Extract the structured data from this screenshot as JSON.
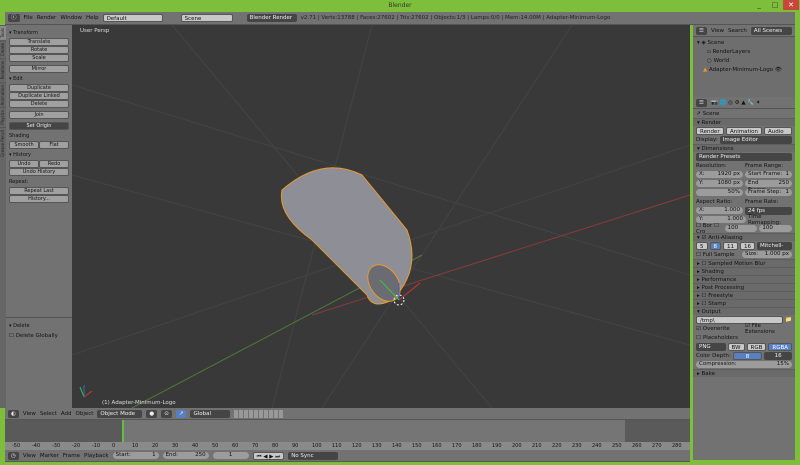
{
  "window": {
    "title": "Blender",
    "min": "_",
    "max": "□",
    "close": "✕"
  },
  "menu": {
    "items": [
      "File",
      "Render",
      "Window",
      "Help"
    ],
    "layout": "Default",
    "scene": "Scene",
    "engine": "Blender Render",
    "stats": "v2.71 | Verts:13788 | Faces:27602 | Tris:27602 | Objects:1/3 | Lamps:0/0 | Mem:14.00M | Adapter-Minimum-Logo"
  },
  "tools": {
    "transform": "Transform",
    "translate": "Translate",
    "rotate": "Rotate",
    "scale": "Scale",
    "mirror": "Mirror",
    "edit": "Edit",
    "duplicate": "Duplicate",
    "duplicate_linked": "Duplicate Linked",
    "delete": "Delete",
    "join": "Join",
    "set_origin": "Set Origin",
    "shading": "Shading",
    "smooth": "Smooth",
    "flat": "Flat",
    "history": "History",
    "undo": "Undo",
    "redo": "Redo",
    "undo_history": "Undo History",
    "repeat": "Repeat:",
    "repeat_last": "Repeat Last",
    "history_btn": "History...",
    "op_delete": "Delete",
    "delete_globally": "Delete Globally",
    "tabs": [
      "Tools",
      "Create",
      "Relations",
      "Animation",
      "Physics",
      "Grease Pencil"
    ]
  },
  "viewport": {
    "label": "User Persp",
    "object": "(1) Adapter-Minimum-Logo"
  },
  "view_header": {
    "items": [
      "View",
      "Select",
      "Add",
      "Object"
    ],
    "mode": "Object Mode",
    "orientation": "Global"
  },
  "timeline": {
    "ticks": [
      "-50",
      "-40",
      "-30",
      "-20",
      "-10",
      "0",
      "10",
      "20",
      "30",
      "40",
      "50",
      "60",
      "70",
      "80",
      "90",
      "100",
      "110",
      "120",
      "130",
      "140",
      "150",
      "160",
      "170",
      "180",
      "190",
      "200",
      "210",
      "220",
      "230",
      "240",
      "250",
      "260",
      "270",
      "280"
    ],
    "menu": [
      "View",
      "Marker",
      "Frame",
      "Playback"
    ],
    "start": "Start:",
    "start_val": "1",
    "end": "End:",
    "end_val": "250",
    "current": "1",
    "sync": "No Sync"
  },
  "outliner": {
    "view": "View",
    "search": "Search",
    "scenes": "All Scenes",
    "items": [
      "Scene",
      "RenderLayers",
      "World",
      "Adapter-Minimum-Logo"
    ]
  },
  "props": {
    "scene": "Scene",
    "render": "Render",
    "render_btn": "Render",
    "animation_btn": "Animation",
    "audio_btn": "Audio",
    "display": "Display:",
    "display_val": "Image Editor",
    "dimensions": "Dimensions",
    "presets": "Render Presets",
    "resolution": "Resolution:",
    "res_x": "X:",
    "res_x_val": "1920 px",
    "res_y": "Y:",
    "res_y_val": "1080 px",
    "res_pct": "50%",
    "frame_range": "Frame Range:",
    "start_frame": "Start Frame:",
    "start_frame_val": "1",
    "end_frame": "End Frame:",
    "end_frame_val": "250",
    "frame_step": "Frame Step:",
    "frame_step_val": "1",
    "aspect": "Aspect Ratio:",
    "asp_x": "X:",
    "asp_x_val": "1.000",
    "asp_y": "Y:",
    "asp_y_val": "1.000",
    "frame_rate": "Frame Rate:",
    "fps": "24 fps",
    "remap": "Time Remapping:",
    "remap_old": "100",
    "remap_new": "100",
    "border": "Bor",
    "crop": "Cro",
    "aa": "Anti-Aliasing",
    "aa_levels": [
      "5",
      "8",
      "11",
      "16"
    ],
    "filter": "Mitchell-Netravali",
    "full_sample": "Full Sample",
    "size": "Size:",
    "size_val": "1.000 px",
    "panels": [
      "Sampled Motion Blur",
      "Shading",
      "Performance",
      "Post Processing",
      "Freestyle",
      "Stamp"
    ],
    "output": "Output",
    "path": "/tmp\\",
    "overwrite": "Overwrite",
    "file_ext": "File Extensions",
    "placeholders": "Placeholders",
    "format": "PNG",
    "bw": "BW",
    "rgb": "RGB",
    "rgba": "RGBA",
    "color_depth": "Color Depth:",
    "depth_8": "8",
    "depth_16": "16",
    "compression": "Compression:",
    "compression_val": "15%",
    "bake": "Bake"
  }
}
